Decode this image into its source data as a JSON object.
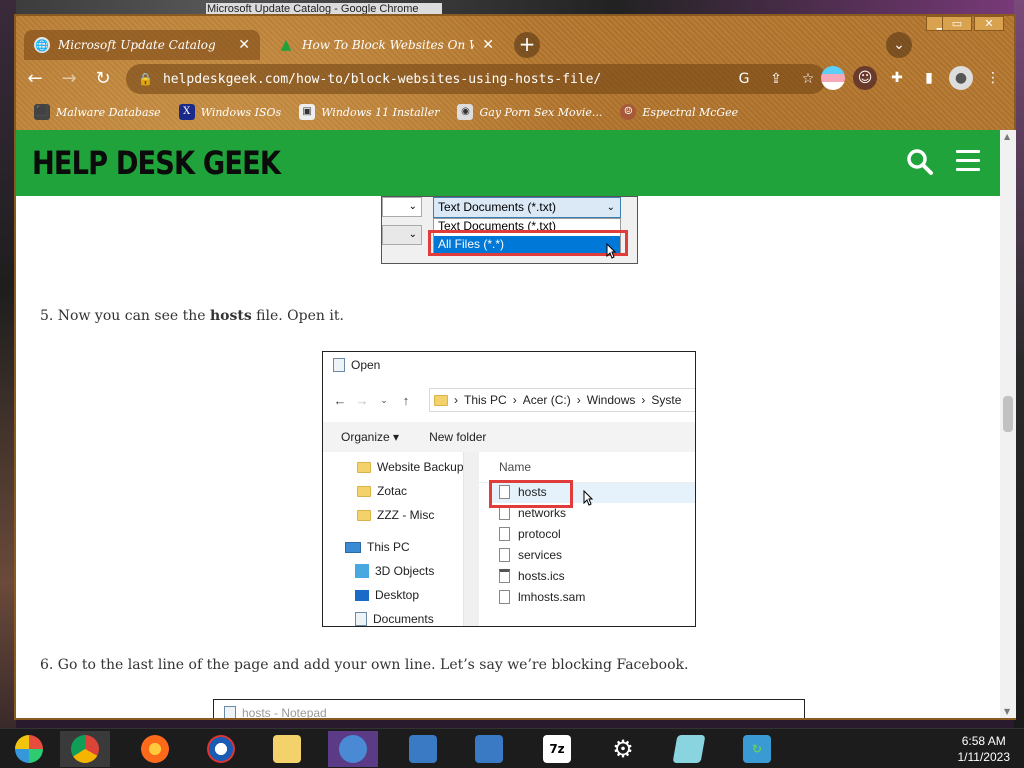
{
  "os": {
    "window_title": "Microsoft Update Catalog - Google Chrome"
  },
  "browser": {
    "tabs": [
      {
        "title": "Microsoft Update Catalog",
        "icon": "globe-icon"
      },
      {
        "title": "How To Block Websites On Windows",
        "icon": "helpdeskgeek-icon"
      }
    ],
    "url": "helpdeskgeek.com/how-to/block-websites-using-hosts-file/",
    "bookmarks": [
      {
        "label": "Malware Database",
        "icon": "malware-icon"
      },
      {
        "label": "Windows ISOs",
        "icon": "x-icon"
      },
      {
        "label": "Windows 11 Installer",
        "icon": "image-icon"
      },
      {
        "label": "Gay Porn Sex Movie...",
        "icon": "site-icon"
      },
      {
        "label": "Espectral McGee",
        "icon": "avatar-icon"
      }
    ]
  },
  "site": {
    "logo": "HELP DESK GEEK"
  },
  "filetype_shot": {
    "selected": "Text Documents (*.txt)",
    "options": [
      "Text Documents (*.txt)",
      "All Files  (*.*)"
    ]
  },
  "article": {
    "step5_prefix": "5. Now you can see the ",
    "step5_bold": "hosts",
    "step5_suffix": " file. Open it.",
    "step6": "6. Go to the last line of the page and add your own line. Let’s say we’re blocking Facebook."
  },
  "open_dialog": {
    "title": "Open",
    "crumbs": [
      "This PC",
      "Acer (C:)",
      "Windows",
      "Syste"
    ],
    "organize": "Organize ▾",
    "new_folder": "New folder",
    "nav_items": [
      "Website Backups",
      "Zotac",
      "ZZZ - Misc",
      "This PC",
      "3D Objects",
      "Desktop",
      "Documents"
    ],
    "column_header": "Name",
    "files": [
      "hosts",
      "networks",
      "protocol",
      "services",
      "hosts.ics",
      "lmhosts.sam"
    ]
  },
  "notepad_shot": {
    "title": "hosts - Notepad"
  },
  "taskbar": {
    "apps": [
      "windows-start-icon",
      "chrome-icon",
      "firefox-icon",
      "obama-icon",
      "file-explorer-icon",
      "remote-users-icon",
      "network-drive-icon",
      "network-drive-2-icon",
      "7zip-icon",
      "settings-icon",
      "notepad-icon",
      "update-icon"
    ],
    "sevenzip_label": "7z",
    "time": "6:58 AM",
    "date": "1/11/2023"
  }
}
